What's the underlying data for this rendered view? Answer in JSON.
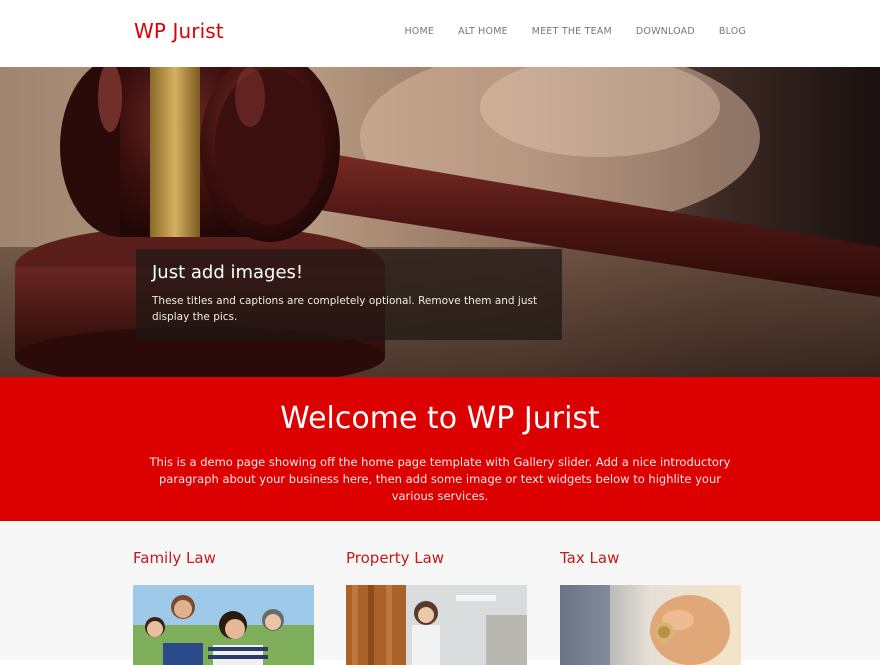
{
  "site": {
    "logo": "WP Jurist"
  },
  "nav": {
    "items": [
      {
        "label": "HOME"
      },
      {
        "label": "ALT HOME"
      },
      {
        "label": "MEET THE TEAM"
      },
      {
        "label": "DOWNLOAD"
      },
      {
        "label": "BLOG"
      }
    ]
  },
  "hero": {
    "caption_title": "Just add images!",
    "caption_text": "These titles and captions are completely optional. Remove them and just display the pics."
  },
  "welcome": {
    "title": "Welcome to WP Jurist",
    "text": "This is a demo page showing off the home page template with Gallery slider. Add a nice introductory paragraph about your business here, then add some image or text widgets below to highlite your various services."
  },
  "services": [
    {
      "title": "Family Law",
      "image": "family-photo"
    },
    {
      "title": "Property Law",
      "image": "property-photo"
    },
    {
      "title": "Tax Law",
      "image": "tax-photo"
    }
  ],
  "colors": {
    "brand_red": "#dd0000",
    "heading_red": "#c41a1a",
    "nav_gray": "#777777",
    "services_bg": "#f7f7f7"
  }
}
